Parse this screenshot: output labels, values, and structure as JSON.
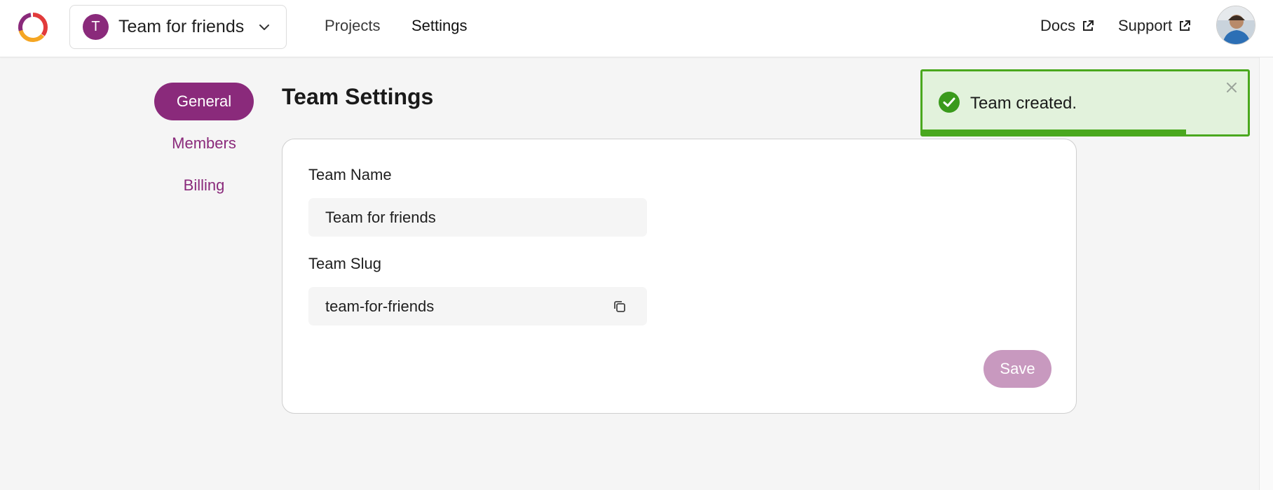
{
  "header": {
    "team_switcher": {
      "initial": "T",
      "name": "Team for friends"
    },
    "nav": {
      "projects": "Projects",
      "settings": "Settings"
    },
    "external": {
      "docs": "Docs",
      "support": "Support"
    }
  },
  "sidebar": {
    "items": [
      {
        "label": "General",
        "active": true
      },
      {
        "label": "Members",
        "active": false
      },
      {
        "label": "Billing",
        "active": false
      }
    ]
  },
  "main": {
    "title": "Team Settings",
    "form": {
      "team_name_label": "Team Name",
      "team_name_value": "Team for friends",
      "team_slug_label": "Team Slug",
      "team_slug_value": "team-for-friends",
      "save_label": "Save"
    }
  },
  "toast": {
    "message": "Team created.",
    "progress": 0.81,
    "status_color": "#4aa81e"
  },
  "colors": {
    "brand": "#8a2a7b",
    "brand_disabled": "#c899bf",
    "success_bg": "#e2f2dc"
  },
  "icons": {
    "logo": "app-logo-icon",
    "chevron": "chevron-down-icon",
    "external": "external-link-icon",
    "copy": "copy-icon",
    "check": "check-circle-icon",
    "close": "close-icon"
  }
}
